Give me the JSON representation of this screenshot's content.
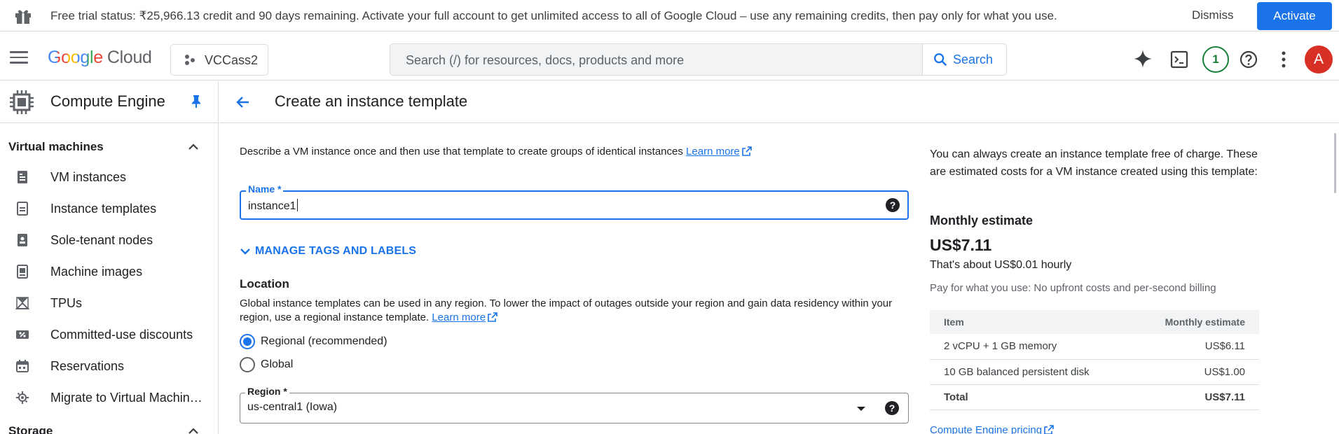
{
  "banner": {
    "message": "Free trial status: ₹25,966.13 credit and 90 days remaining. Activate your full account to get unlimited access to all of Google Cloud – use any remaining credits, then pay only for what you use.",
    "dismiss_label": "Dismiss",
    "activate_label": "Activate",
    "icon": "gift-icon"
  },
  "topbar": {
    "logo_google": "Google",
    "logo_cloud": "Cloud",
    "project_name": "VCCass2",
    "search_placeholder": "Search (/) for resources, docs, products and more",
    "search_button": "Search",
    "notification_count": "1",
    "avatar_letter": "A",
    "icons": [
      "menu-icon",
      "gemini-sparkle-icon",
      "cloud-shell-icon",
      "help-icon",
      "more-vert-icon"
    ]
  },
  "sidebar": {
    "title": "Compute Engine",
    "sections": [
      {
        "label": "Virtual machines",
        "items": [
          {
            "label": "VM instances",
            "icon": "vm-instances-icon"
          },
          {
            "label": "Instance templates",
            "icon": "instance-templates-icon"
          },
          {
            "label": "Sole-tenant nodes",
            "icon": "sole-tenant-icon"
          },
          {
            "label": "Machine images",
            "icon": "machine-images-icon"
          },
          {
            "label": "TPUs",
            "icon": "tpu-icon"
          },
          {
            "label": "Committed-use discounts",
            "icon": "discount-icon"
          },
          {
            "label": "Reservations",
            "icon": "calendar-icon"
          },
          {
            "label": "Migrate to Virtual Machin…",
            "icon": "migrate-icon"
          }
        ]
      },
      {
        "label": "Storage",
        "items": []
      }
    ]
  },
  "page": {
    "title": "Create an instance template",
    "description": "Describe a VM instance once and then use that template to create groups of identical instances",
    "learn_more": "Learn more",
    "name_label": "Name *",
    "name_value": "instance1",
    "manage_tags": "MANAGE TAGS AND LABELS",
    "location_title": "Location",
    "location_desc": "Global instance templates can be used in any region. To lower the impact of outages outside your region and gain data residency within your region, use a regional instance template.",
    "location_learn_more": "Learn more",
    "radio_regional": "Regional (recommended)",
    "radio_global": "Global",
    "region_label": "Region *",
    "region_value": "us-central1 (Iowa)"
  },
  "estimate": {
    "intro": "You can always create an instance template free of charge. These are estimated costs for a VM instance created using this template:",
    "heading": "Monthly estimate",
    "amount": "US$7.11",
    "hourly": "That's about US$0.01 hourly",
    "pay_note": "Pay for what you use: No upfront costs and per-second billing",
    "col_item": "Item",
    "col_estimate": "Monthly estimate",
    "rows": [
      {
        "item": "2 vCPU + 1 GB memory",
        "cost": "US$6.11"
      },
      {
        "item": "10 GB balanced persistent disk",
        "cost": "US$1.00"
      }
    ],
    "total_label": "Total",
    "total_cost": "US$7.11",
    "pricing_link": "Compute Engine pricing"
  },
  "colors": {
    "primary": "#1a73e8",
    "avatar": "#d93025",
    "notification": "#188038"
  }
}
